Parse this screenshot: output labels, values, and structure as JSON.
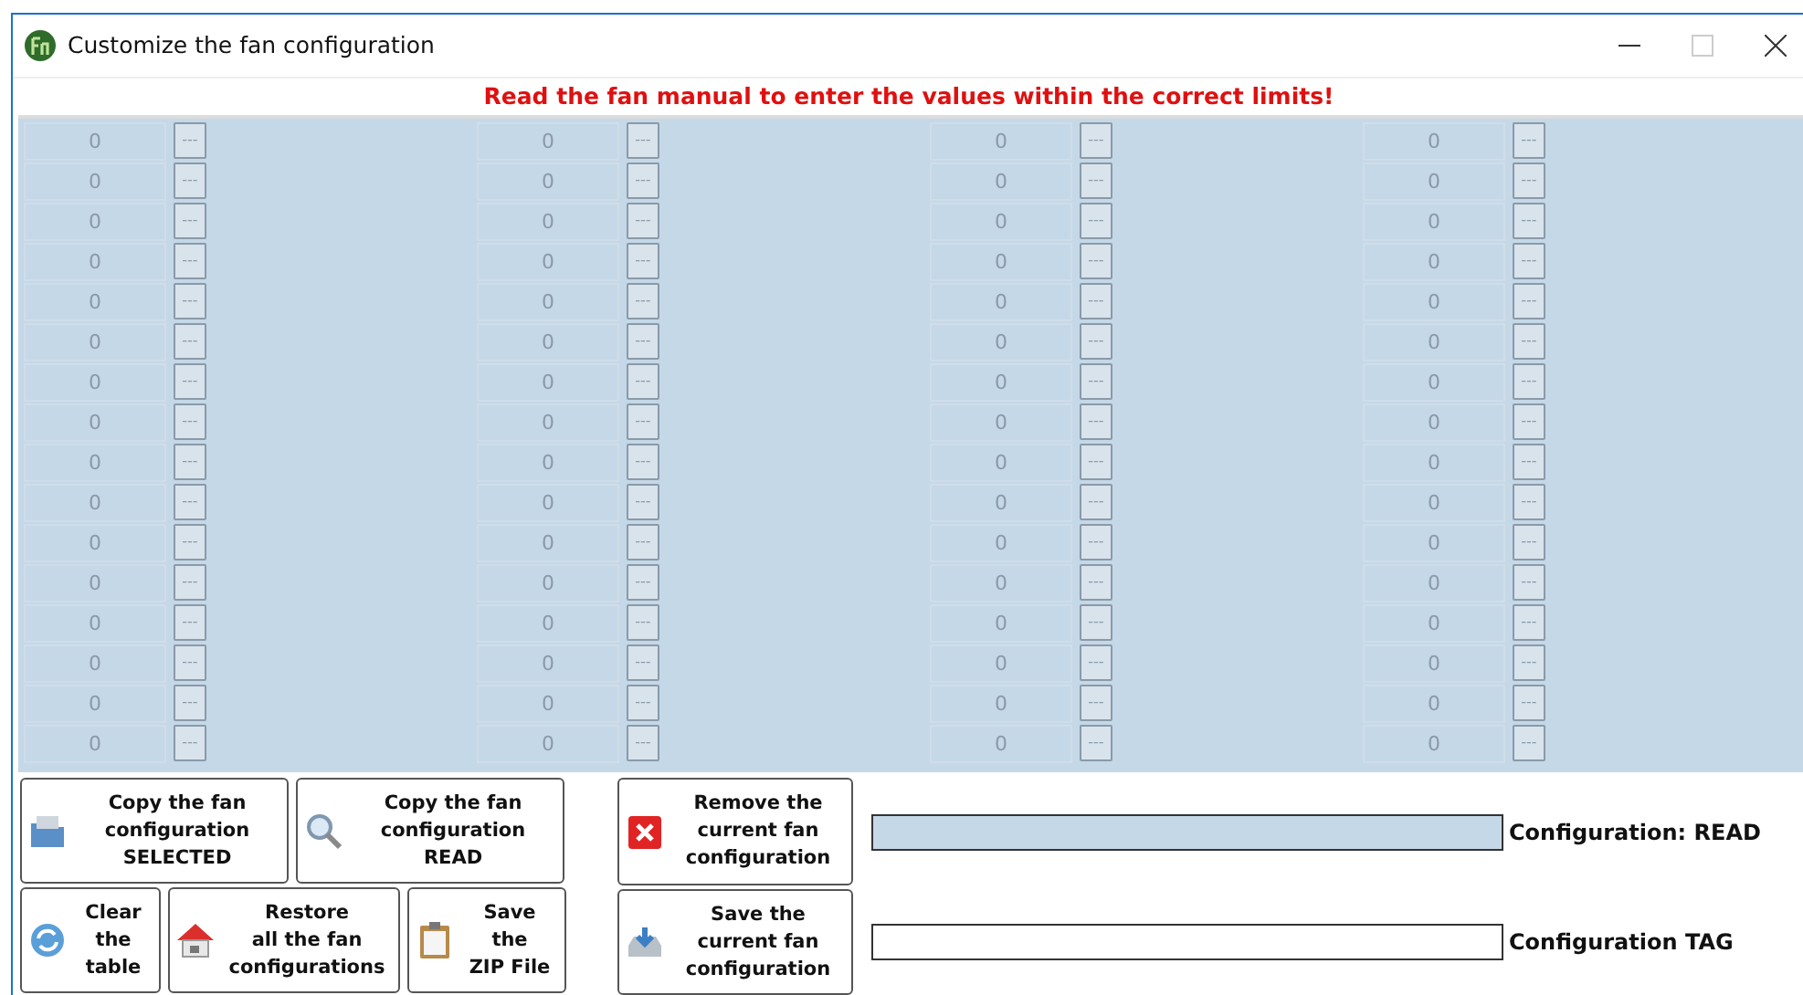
{
  "window": {
    "title": "Customize the fan configuration",
    "maximize_disabled": true
  },
  "warning": "Read the fan manual to enter the values within the correct limits!",
  "grid": {
    "disabled": true,
    "rows": [
      [
        {
          "value": "0",
          "button": "---"
        },
        {
          "value": "0",
          "button": "---"
        },
        {
          "value": "0",
          "button": "---"
        },
        {
          "value": "0",
          "button": "---"
        }
      ],
      [
        {
          "value": "0",
          "button": "---"
        },
        {
          "value": "0",
          "button": "---"
        },
        {
          "value": "0",
          "button": "---"
        },
        {
          "value": "0",
          "button": "---"
        }
      ],
      [
        {
          "value": "0",
          "button": "---"
        },
        {
          "value": "0",
          "button": "---"
        },
        {
          "value": "0",
          "button": "---"
        },
        {
          "value": "0",
          "button": "---"
        }
      ],
      [
        {
          "value": "0",
          "button": "---"
        },
        {
          "value": "0",
          "button": "---"
        },
        {
          "value": "0",
          "button": "---"
        },
        {
          "value": "0",
          "button": "---"
        }
      ],
      [
        {
          "value": "0",
          "button": "---"
        },
        {
          "value": "0",
          "button": "---"
        },
        {
          "value": "0",
          "button": "---"
        },
        {
          "value": "0",
          "button": "---"
        }
      ],
      [
        {
          "value": "0",
          "button": "---"
        },
        {
          "value": "0",
          "button": "---"
        },
        {
          "value": "0",
          "button": "---"
        },
        {
          "value": "0",
          "button": "---"
        }
      ],
      [
        {
          "value": "0",
          "button": "---"
        },
        {
          "value": "0",
          "button": "---"
        },
        {
          "value": "0",
          "button": "---"
        },
        {
          "value": "0",
          "button": "---"
        }
      ],
      [
        {
          "value": "0",
          "button": "---"
        },
        {
          "value": "0",
          "button": "---"
        },
        {
          "value": "0",
          "button": "---"
        },
        {
          "value": "0",
          "button": "---"
        }
      ],
      [
        {
          "value": "0",
          "button": "---"
        },
        {
          "value": "0",
          "button": "---"
        },
        {
          "value": "0",
          "button": "---"
        },
        {
          "value": "0",
          "button": "---"
        }
      ],
      [
        {
          "value": "0",
          "button": "---"
        },
        {
          "value": "0",
          "button": "---"
        },
        {
          "value": "0",
          "button": "---"
        },
        {
          "value": "0",
          "button": "---"
        }
      ],
      [
        {
          "value": "0",
          "button": "---"
        },
        {
          "value": "0",
          "button": "---"
        },
        {
          "value": "0",
          "button": "---"
        },
        {
          "value": "0",
          "button": "---"
        }
      ],
      [
        {
          "value": "0",
          "button": "---"
        },
        {
          "value": "0",
          "button": "---"
        },
        {
          "value": "0",
          "button": "---"
        },
        {
          "value": "0",
          "button": "---"
        }
      ],
      [
        {
          "value": "0",
          "button": "---"
        },
        {
          "value": "0",
          "button": "---"
        },
        {
          "value": "0",
          "button": "---"
        },
        {
          "value": "0",
          "button": "---"
        }
      ],
      [
        {
          "value": "0",
          "button": "---"
        },
        {
          "value": "0",
          "button": "---"
        },
        {
          "value": "0",
          "button": "---"
        },
        {
          "value": "0",
          "button": "---"
        }
      ],
      [
        {
          "value": "0",
          "button": "---"
        },
        {
          "value": "0",
          "button": "---"
        },
        {
          "value": "0",
          "button": "---"
        },
        {
          "value": "0",
          "button": "---"
        }
      ],
      [
        {
          "value": "0",
          "button": "---"
        },
        {
          "value": "0",
          "button": "---"
        },
        {
          "value": "0",
          "button": "---"
        },
        {
          "value": "0",
          "button": "---"
        }
      ]
    ]
  },
  "buttons": [
    {
      "kind": "folder",
      "lines": [
        "Copy the fan",
        "configuration",
        "SELECTED"
      ]
    },
    {
      "kind": "search",
      "lines": [
        "Copy the fan",
        "configuration",
        "READ"
      ]
    },
    {
      "kind": "remove",
      "lines": [
        "Remove the",
        "current fan",
        "configuration"
      ]
    },
    {
      "kind": "refresh",
      "lines": [
        "Clear",
        "the",
        "table"
      ]
    },
    {
      "kind": "home",
      "lines": [
        "Restore",
        "all the fan",
        "configurations"
      ]
    },
    {
      "kind": "clipboard",
      "lines": [
        "Save",
        "the",
        "ZIP File"
      ]
    },
    {
      "kind": "save",
      "lines": [
        "Save the",
        "current fan",
        "configuration"
      ]
    }
  ],
  "fields": [
    {
      "label": "Configuration: READ",
      "highlighted": true
    },
    {
      "label": "Configuration TAG",
      "highlighted": false
    }
  ]
}
